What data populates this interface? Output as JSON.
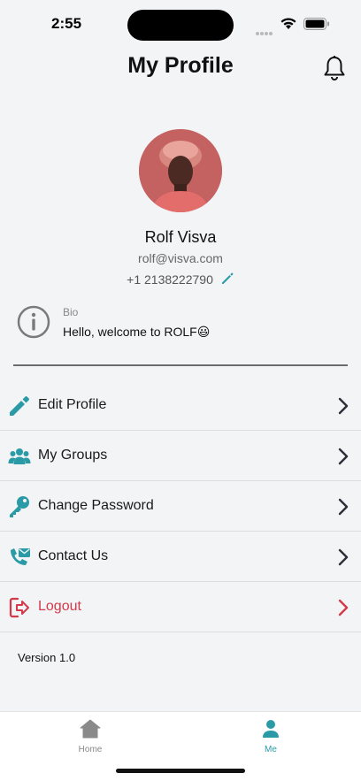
{
  "status_bar": {
    "time": "2:55"
  },
  "header": {
    "title": "My Profile"
  },
  "profile": {
    "name": "Rolf Visva",
    "email": "rolf@visva.com",
    "phone": "+1 2138222790"
  },
  "bio": {
    "label": "Bio",
    "text": "Hello, welcome to ROLF😃"
  },
  "menu": {
    "items": [
      {
        "label": "Edit Profile",
        "icon": "pencil-icon"
      },
      {
        "label": "My Groups",
        "icon": "users-icon"
      },
      {
        "label": "Change Password",
        "icon": "key-icon"
      },
      {
        "label": "Contact Us",
        "icon": "phone-mail-icon"
      },
      {
        "label": "Logout",
        "icon": "logout-icon"
      }
    ]
  },
  "footer": {
    "version": "Version 1.0"
  },
  "tab_bar": {
    "tabs": [
      {
        "label": "Home",
        "icon": "home-icon",
        "active": false
      },
      {
        "label": "Me",
        "icon": "person-icon",
        "active": true
      }
    ]
  },
  "colors": {
    "accent": "#2a9ba6",
    "danger": "#d23a4a",
    "background": "#f3f4f6"
  }
}
